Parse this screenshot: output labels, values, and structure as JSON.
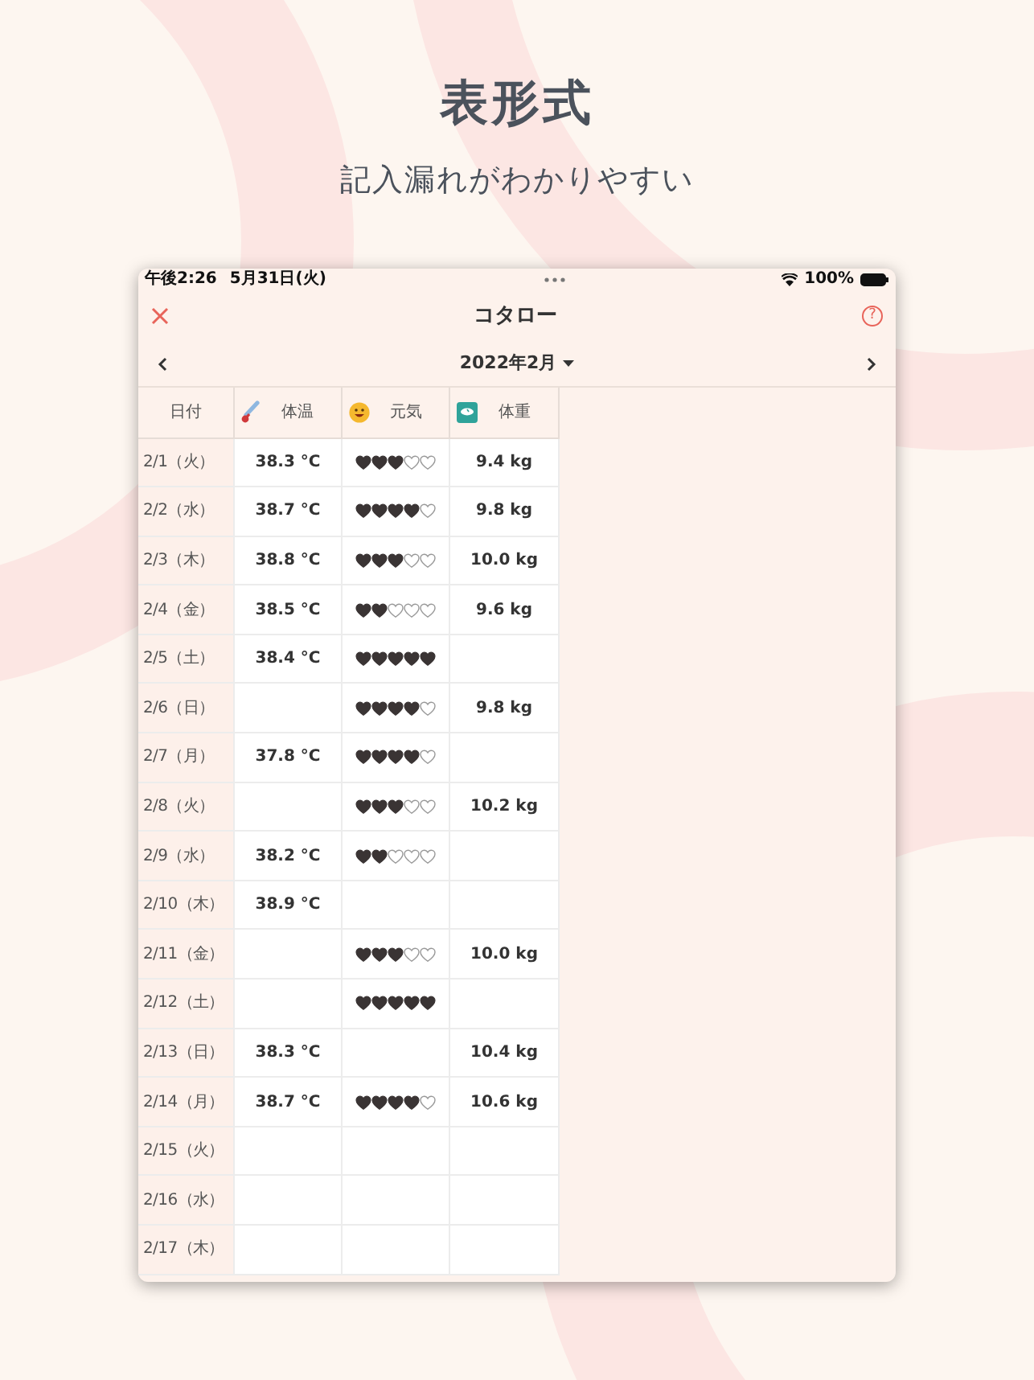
{
  "headline": "表形式",
  "subheadline": "記入漏れがわかりやすい",
  "status_bar": {
    "time": "午後2:26",
    "date": "5月31日(火)",
    "battery": "100%"
  },
  "nav": {
    "title": "コタロー",
    "help": "?"
  },
  "month": {
    "label": "2022年2月"
  },
  "table": {
    "columns": [
      {
        "label": "日付",
        "kind": "date"
      },
      {
        "label": "体温",
        "kind": "temp"
      },
      {
        "label": "元気",
        "kind": "energy"
      },
      {
        "label": "体重",
        "kind": "weight"
      }
    ],
    "rows": [
      {
        "date": "2/1（火）",
        "temp": "38.3 °C",
        "stars": 3,
        "weight": "9.4 kg"
      },
      {
        "date": "2/2（水）",
        "temp": "38.7 °C",
        "stars": 4,
        "weight": "9.8 kg"
      },
      {
        "date": "2/3（木）",
        "temp": "38.8 °C",
        "stars": 3,
        "weight": "10.0 kg"
      },
      {
        "date": "2/4（金）",
        "temp": "38.5 °C",
        "stars": 2,
        "weight": "9.6 kg"
      },
      {
        "date": "2/5（土）",
        "temp": "38.4 °C",
        "stars": 5
      },
      {
        "date": "2/6（日）",
        "stars": 4,
        "weight": "9.8 kg"
      },
      {
        "date": "2/7（月）",
        "temp": "37.8 °C",
        "stars": 4
      },
      {
        "date": "2/8（火）",
        "stars": 3,
        "weight": "10.2 kg"
      },
      {
        "date": "2/9（水）",
        "temp": "38.2 °C",
        "stars": 2
      },
      {
        "date": "2/10（木）",
        "temp": "38.9 °C"
      },
      {
        "date": "2/11（金）",
        "stars": 3,
        "weight": "10.0 kg"
      },
      {
        "date": "2/12（土）",
        "stars": 5
      },
      {
        "date": "2/13（日）",
        "temp": "38.3 °C",
        "weight": "10.4 kg"
      },
      {
        "date": "2/14（月）",
        "temp": "38.7 °C",
        "stars": 4,
        "weight": "10.6 kg"
      },
      {
        "date": "2/15（火）"
      },
      {
        "date": "2/16（水）"
      },
      {
        "date": "2/17（木）"
      }
    ]
  }
}
